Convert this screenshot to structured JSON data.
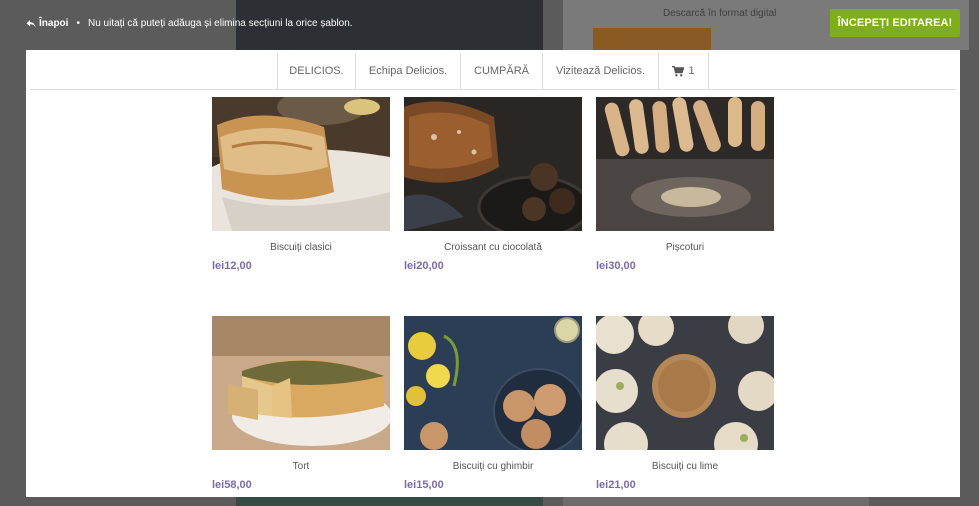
{
  "topbar": {
    "back_label": "Înapoi",
    "separator": "•",
    "notice": "Nu uitați că puteți adăuga și elimina secțiuni la orice șablon.",
    "cta_label": "ÎNCEPEȚI EDITAREA!"
  },
  "background": {
    "download_text": "Descarcă în format digital"
  },
  "nav": {
    "items": [
      "DELICIOS.",
      "Echipa Delicios.",
      "CUMPĂRĂ",
      "Vizitează Delicios."
    ],
    "cart_count": "1"
  },
  "products": [
    {
      "name": "Biscuiți clasici",
      "price": "lei12,00"
    },
    {
      "name": "Croissant cu ciocolată",
      "price": "lei20,00"
    },
    {
      "name": "Pișcoturi",
      "price": "lei30,00"
    },
    {
      "name": "Tort",
      "price": "lei58,00"
    },
    {
      "name": "Biscuiți cu ghimbir",
      "price": "lei15,00"
    },
    {
      "name": "Biscuiți cu lime",
      "price": "lei21,00"
    }
  ],
  "colors": {
    "accent_green": "#7fae1b",
    "price_purple": "#7b6ca8",
    "overlay": "#5b5b5b"
  }
}
